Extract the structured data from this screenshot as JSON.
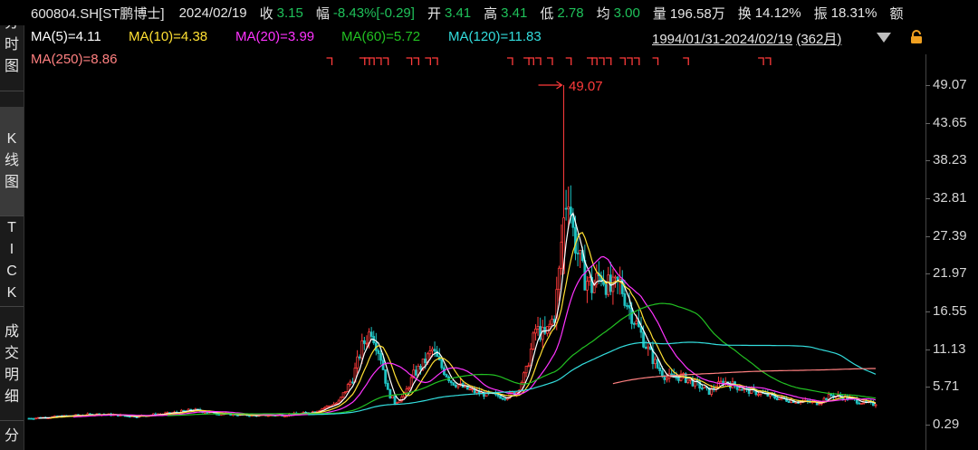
{
  "header": {
    "symbol": "600804.SH[ST鹏博士]",
    "date": "2024/02/19",
    "close_label": "收",
    "close": "3.15",
    "change_label": "幅",
    "change_pct": "-8.43%",
    "change_abs": "[-0.29]",
    "open_label": "开",
    "open": "3.41",
    "high_label": "高",
    "high": "3.41",
    "low_label": "低",
    "low": "2.78",
    "avg_label": "均",
    "avg": "3.00",
    "volume_label": "量",
    "volume": "196.58万",
    "turnover_label": "换",
    "turnover": "14.12%",
    "amplitude_label": "振",
    "amplitude": "18.31%",
    "amount_label": "额"
  },
  "sidebar": {
    "tabs": [
      {
        "label": "分时图",
        "chars": [
          "分",
          "时",
          "图"
        ]
      },
      {
        "label": "K线图",
        "chars": [
          "K",
          "线",
          "图"
        ]
      },
      {
        "label": "TICK",
        "chars": [
          "T",
          "I",
          "C",
          "K"
        ]
      },
      {
        "label": "成交明细",
        "chars": [
          "成",
          "交",
          "明",
          "细"
        ]
      },
      {
        "label": "分",
        "chars": [
          "分"
        ]
      }
    ]
  },
  "ma_labels": {
    "ma5": "MA(5)=4.11",
    "ma10": "MA(10)=4.38",
    "ma20": "MA(20)=3.99",
    "ma60": "MA(60)=5.72",
    "ma120": "MA(120)=11.83",
    "ma250": "MA(250)=8.86"
  },
  "range": {
    "text": "1994/01/31-2024/02/19",
    "count": "(362月)"
  },
  "icons": {
    "dropdown": "triangle-down-icon",
    "lock": "lock-icon"
  },
  "colors": {
    "up": "#ff3b3b",
    "down": "#1fc2c2",
    "ma5": "#ffffff",
    "ma10": "#ffe033",
    "ma20": "#ff33ff",
    "ma60": "#22c022",
    "ma120": "#33dddd",
    "ma250": "#ff8080"
  },
  "max_label": "49.07",
  "y_ticks": [
    "49.07",
    "43.65",
    "38.23",
    "32.81",
    "27.39",
    "21.97",
    "16.55",
    "11.13",
    "5.71",
    "0.29"
  ],
  "chart_data": {
    "type": "candlestick",
    "title": "600804.SH[ST鹏博士]",
    "period": "monthly",
    "x_range": [
      "1994/01/31",
      "2024/02/19"
    ],
    "bar_count": 362,
    "ylim": [
      0.29,
      49.07
    ],
    "max_high": 49.07,
    "last_close": 3.15,
    "series": [
      {
        "name": "MA(5)",
        "last": 4.11,
        "color": "#ffffff"
      },
      {
        "name": "MA(10)",
        "last": 4.38,
        "color": "#ffe033"
      },
      {
        "name": "MA(20)",
        "last": 3.99,
        "color": "#ff33ff"
      },
      {
        "name": "MA(60)",
        "last": 5.72,
        "color": "#22c022"
      },
      {
        "name": "MA(120)",
        "last": 11.83,
        "color": "#33dddd"
      },
      {
        "name": "MA(250)",
        "last": 8.86,
        "color": "#ff8080"
      }
    ],
    "price_path": [
      [
        0,
        1.2
      ],
      [
        15,
        1.5
      ],
      [
        30,
        1.8
      ],
      [
        45,
        1.5
      ],
      [
        60,
        1.9
      ],
      [
        70,
        2.4
      ],
      [
        80,
        1.9
      ],
      [
        95,
        1.6
      ],
      [
        110,
        1.7
      ],
      [
        120,
        2.0
      ],
      [
        132,
        3.5
      ],
      [
        138,
        7.0
      ],
      [
        142,
        11.5
      ],
      [
        146,
        14.0
      ],
      [
        150,
        10.0
      ],
      [
        153,
        5.0
      ],
      [
        156,
        3.5
      ],
      [
        160,
        4.5
      ],
      [
        164,
        7.5
      ],
      [
        168,
        9.0
      ],
      [
        172,
        11.0
      ],
      [
        176,
        8.5
      ],
      [
        180,
        6.5
      ],
      [
        186,
        5.5
      ],
      [
        192,
        4.8
      ],
      [
        198,
        4.5
      ],
      [
        203,
        4.3
      ],
      [
        208,
        5.0
      ],
      [
        212,
        8.0
      ],
      [
        216,
        14.0
      ],
      [
        220,
        13.0
      ],
      [
        224,
        16.0
      ],
      [
        226,
        22.0
      ],
      [
        228,
        31.0
      ],
      [
        230,
        34.0
      ],
      [
        232,
        28.0
      ],
      [
        234,
        25.0
      ],
      [
        236,
        22.0
      ],
      [
        240,
        20.0
      ],
      [
        244,
        22.0
      ],
      [
        248,
        19.5
      ],
      [
        252,
        20.5
      ],
      [
        256,
        17.0
      ],
      [
        260,
        14.0
      ],
      [
        264,
        11.0
      ],
      [
        268,
        8.5
      ],
      [
        272,
        7.0
      ],
      [
        278,
        7.2
      ],
      [
        284,
        6.2
      ],
      [
        290,
        5.0
      ],
      [
        296,
        6.5
      ],
      [
        300,
        6.0
      ],
      [
        306,
        5.2
      ],
      [
        312,
        4.8
      ],
      [
        318,
        4.2
      ],
      [
        324,
        3.8
      ],
      [
        330,
        3.6
      ],
      [
        336,
        3.4
      ],
      [
        342,
        4.5
      ],
      [
        348,
        4.2
      ],
      [
        354,
        3.6
      ],
      [
        361,
        3.15
      ]
    ]
  }
}
